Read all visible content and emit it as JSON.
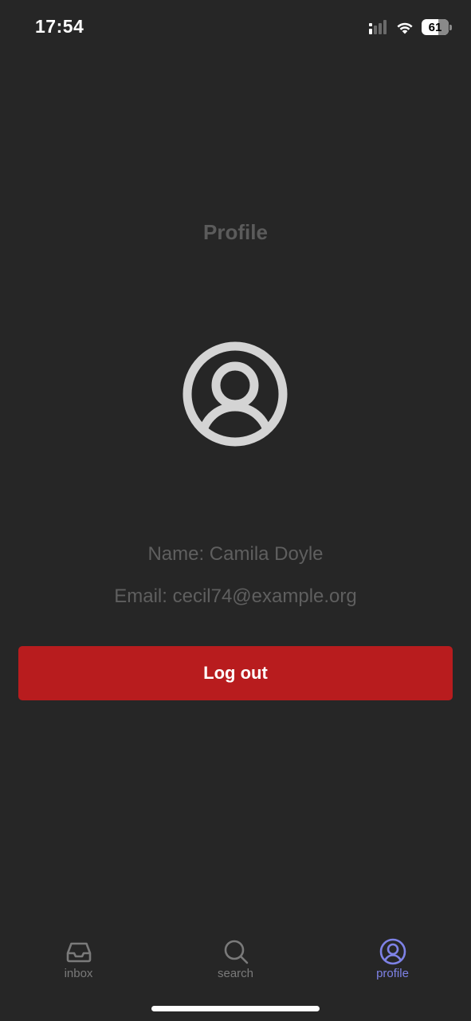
{
  "status_bar": {
    "time": "17:54",
    "battery_level": "61",
    "icons": [
      "signal-icon",
      "wifi-icon",
      "battery-icon"
    ]
  },
  "page": {
    "title": "Profile",
    "avatar_icon": "user-circle-icon",
    "name_text": "Name: Camila Doyle",
    "email_text": "Email: cecil74@example.org",
    "logout_label": "Log out"
  },
  "tab_bar": {
    "tabs": [
      {
        "label": "inbox",
        "icon": "inbox-icon",
        "active": false
      },
      {
        "label": "search",
        "icon": "search-icon",
        "active": false
      },
      {
        "label": "profile",
        "icon": "user-circle-icon",
        "active": true
      }
    ]
  },
  "colors": {
    "background": "#262626",
    "logout_button": "#b81c1e",
    "active_tab": "#7e82e6",
    "inactive_tab": "#7a7a7a"
  }
}
